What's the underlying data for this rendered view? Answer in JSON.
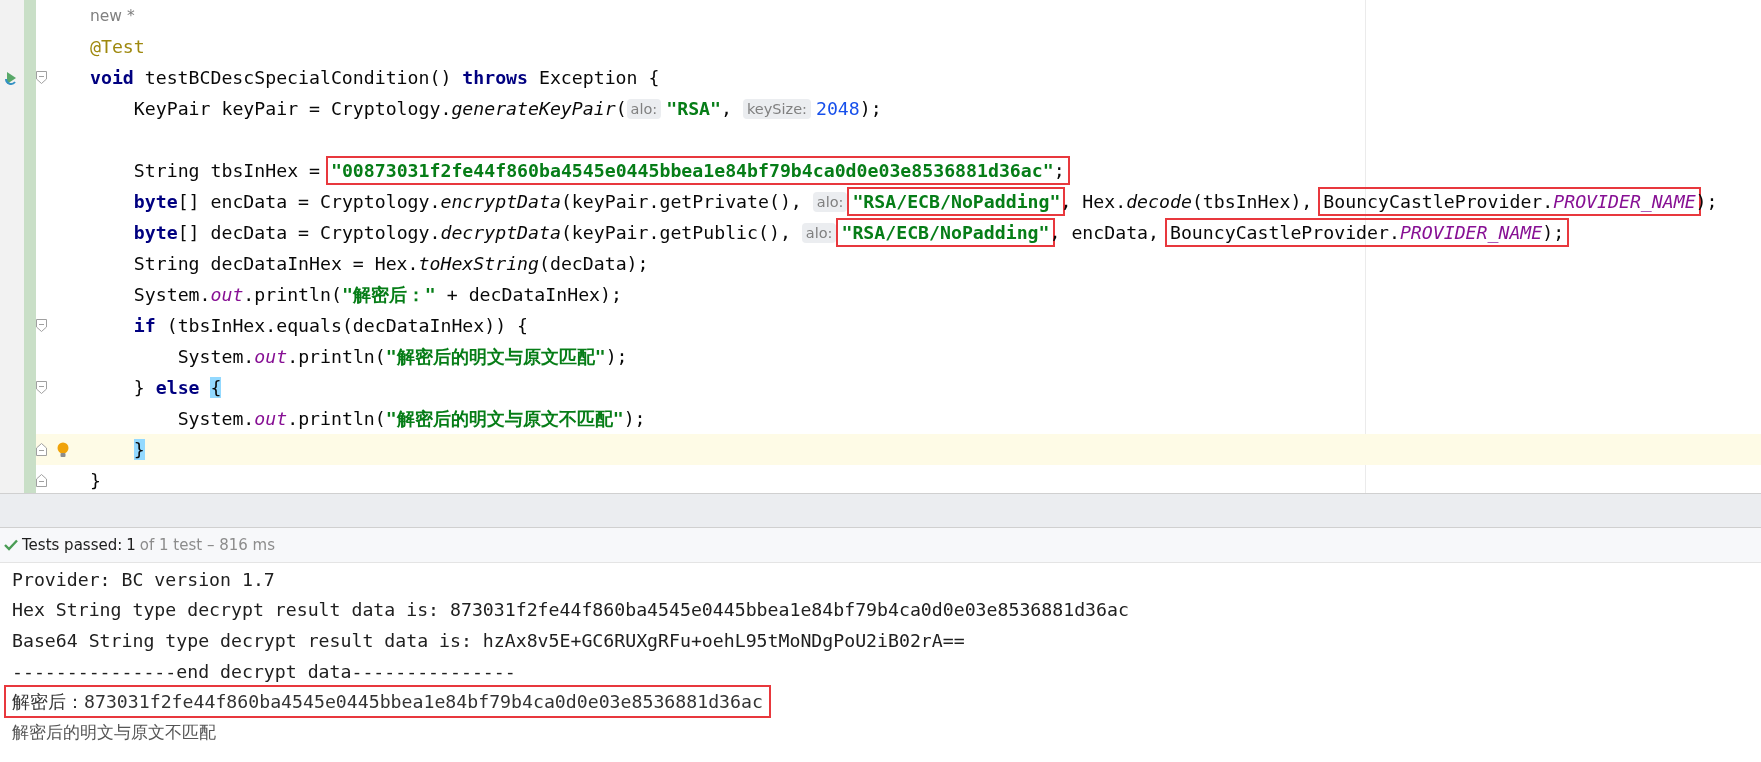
{
  "editor": {
    "lines": [
      {
        "run": false,
        "fold_start": false,
        "fold_end": false,
        "bulb": false,
        "current": false,
        "segments": [
          {
            "kind": "vision",
            "text": "new *"
          }
        ]
      },
      {
        "run": false,
        "fold_start": false,
        "fold_end": false,
        "bulb": false,
        "current": false,
        "segments": [
          {
            "kind": "annotation",
            "text": "@Test"
          }
        ]
      },
      {
        "run": true,
        "fold_start": true,
        "fold_end": false,
        "bulb": false,
        "current": false,
        "segments": [
          {
            "kind": "keyword",
            "text": "void"
          },
          {
            "kind": "plain",
            "text": " testBCDescSpecialCondition() "
          },
          {
            "kind": "keyword",
            "text": "throws"
          },
          {
            "kind": "plain",
            "text": " Exception {"
          }
        ],
        "children": [
          {
            "run": false,
            "fold_start": false,
            "fold_end": false,
            "bulb": false,
            "current": false,
            "segments": [
              {
                "kind": "plain",
                "text": "KeyPair keyPair = Cryptology."
              },
              {
                "kind": "method",
                "text": "generateKeyPair"
              },
              {
                "kind": "plain",
                "text": "("
              },
              {
                "kind": "hint",
                "text": "alo:"
              },
              {
                "kind": "string",
                "text": "\"RSA\""
              },
              {
                "kind": "plain",
                "text": ", "
              },
              {
                "kind": "hint",
                "text": "keySize:"
              },
              {
                "kind": "number",
                "text": "2048"
              },
              {
                "kind": "plain",
                "text": ");"
              }
            ]
          },
          {
            "run": false,
            "fold_start": false,
            "fold_end": false,
            "bulb": false,
            "current": false
          },
          {
            "run": false,
            "fold_start": false,
            "fold_end": false,
            "bulb": false,
            "current": false,
            "segments": [
              {
                "kind": "plain",
                "text": "String tbsInHex = "
              },
              {
                "kind": "group",
                "boxed": true,
                "parts": [
                  {
                    "kind": "string",
                    "text": "\"00873031f2fe44f860ba4545e0445bbea1e84bf79b4ca0d0e03e8536881d36ac\""
                  },
                  {
                    "kind": "plain",
                    "text": ";"
                  }
                ]
              }
            ]
          },
          {
            "run": false,
            "fold_start": false,
            "fold_end": false,
            "bulb": false,
            "current": false,
            "segments": [
              {
                "kind": "keyword",
                "text": "byte"
              },
              {
                "kind": "plain",
                "text": "[] encData = Cryptology."
              },
              {
                "kind": "method",
                "text": "encryptData"
              },
              {
                "kind": "plain",
                "text": "(keyPair.getPrivate(), "
              },
              {
                "kind": "hint",
                "text": "alo:"
              },
              {
                "kind": "group",
                "boxed": true,
                "parts": [
                  {
                    "kind": "string",
                    "text": "\"RSA/ECB/NoPadding\""
                  }
                ]
              },
              {
                "kind": "plain",
                "text": ", Hex."
              },
              {
                "kind": "method",
                "text": "decode"
              },
              {
                "kind": "plain",
                "text": "(tbsInHex), "
              },
              {
                "kind": "group",
                "boxed": true,
                "parts": [
                  {
                    "kind": "plain",
                    "text": "BouncyCastleProvider."
                  },
                  {
                    "kind": "field",
                    "text": "PROVIDER_NAME"
                  }
                ]
              },
              {
                "kind": "plain",
                "text": ");"
              }
            ]
          },
          {
            "run": false,
            "fold_start": false,
            "fold_end": false,
            "bulb": false,
            "current": false,
            "segments": [
              {
                "kind": "keyword",
                "text": "byte"
              },
              {
                "kind": "plain",
                "text": "[] decData = Cryptology."
              },
              {
                "kind": "method",
                "text": "decryptData"
              },
              {
                "kind": "plain",
                "text": "(keyPair.getPublic(), "
              },
              {
                "kind": "hint",
                "text": "alo:"
              },
              {
                "kind": "group",
                "boxed": true,
                "parts": [
                  {
                    "kind": "string",
                    "text": "\"RSA/ECB/NoPadding\""
                  }
                ]
              },
              {
                "kind": "plain",
                "text": ", encData, "
              },
              {
                "kind": "group",
                "boxed": true,
                "parts": [
                  {
                    "kind": "plain",
                    "text": "BouncyCastleProvider."
                  },
                  {
                    "kind": "field",
                    "text": "PROVIDER_NAME"
                  },
                  {
                    "kind": "plain",
                    "text": ");"
                  }
                ]
              }
            ]
          },
          {
            "run": false,
            "fold_start": false,
            "fold_end": false,
            "bulb": false,
            "current": false,
            "segments": [
              {
                "kind": "plain",
                "text": "String decDataInHex = Hex."
              },
              {
                "kind": "method",
                "text": "toHexString"
              },
              {
                "kind": "plain",
                "text": "(decData);"
              }
            ]
          },
          {
            "run": false,
            "fold_start": false,
            "fold_end": false,
            "bulb": false,
            "current": false,
            "segments": [
              {
                "kind": "plain",
                "text": "System."
              },
              {
                "kind": "field",
                "text": "out"
              },
              {
                "kind": "plain",
                "text": ".println("
              },
              {
                "kind": "string",
                "text": "\"解密后：\""
              },
              {
                "kind": "plain",
                "text": " + decDataInHex);"
              }
            ]
          },
          {
            "run": false,
            "fold_start": true,
            "fold_end": false,
            "bulb": false,
            "current": false,
            "segments": [
              {
                "kind": "keyword",
                "text": "if"
              },
              {
                "kind": "plain",
                "text": " (tbsInHex.equals(decDataInHex)) {"
              }
            ],
            "children": [
              {
                "run": false,
                "fold_start": false,
                "fold_end": false,
                "bulb": false,
                "current": false,
                "segments": [
                  {
                    "kind": "plain",
                    "text": "System."
                  },
                  {
                    "kind": "field",
                    "text": "out"
                  },
                  {
                    "kind": "plain",
                    "text": ".println("
                  },
                  {
                    "kind": "string",
                    "text": "\"解密后的明文与原文匹配\""
                  },
                  {
                    "kind": "plain",
                    "text": ");"
                  }
                ]
              }
            ]
          },
          {
            "run": false,
            "fold_start": true,
            "fold_end": false,
            "bulb": false,
            "current": false,
            "segments": [
              {
                "kind": "plain",
                "text": "} "
              },
              {
                "kind": "keyword",
                "text": "else"
              },
              {
                "kind": "brace",
                "text": "{"
              }
            ],
            "children": [
              {
                "run": false,
                "fold_start": false,
                "fold_end": false,
                "bulb": false,
                "current": false,
                "segments": [
                  {
                    "kind": "plain",
                    "text": "System."
                  },
                  {
                    "kind": "field",
                    "text": "out"
                  },
                  {
                    "kind": "plain",
                    "text": ".println("
                  },
                  {
                    "kind": "string",
                    "text": "\"解密后的明文与原文不匹配\""
                  },
                  {
                    "kind": "plain",
                    "text": ");"
                  }
                ]
              }
            ]
          },
          {
            "run": false,
            "fold_start": false,
            "fold_end": true,
            "bulb": true,
            "current": true,
            "segments": [
              {
                "kind": "brace",
                "text": "}"
              }
            ]
          }
        ]
      },
      {
        "run": false,
        "fold_start": false,
        "fold_end": true,
        "bulb": false,
        "current": false,
        "segments": [
          {
            "kind": "plain",
            "text": "}"
          }
        ]
      }
    ]
  },
  "status": {
    "label": "Tests passed:",
    "count": "1",
    "summary": "of 1 test – 816 ms"
  },
  "console": [
    {
      "kind": "mono",
      "boxed": false,
      "text": "Provider: BC version 1.7"
    },
    {
      "kind": "mono",
      "boxed": false,
      "text": "Hex String type decrypt result data is: 873031f2fe44f860ba4545e0445bbea1e84bf79b4ca0d0e03e8536881d36ac"
    },
    {
      "kind": "mono",
      "boxed": false,
      "text": "Base64 String type decrypt result data is: hzAx8v5E+GC6RUXgRFu+oehL95tMoNDgPoU2iB02rA=="
    },
    {
      "kind": "mono",
      "boxed": false,
      "text": "---------------end decrypt data---------------"
    },
    {
      "kind": "mixed",
      "boxed": true,
      "text": "解密后：873031f2fe44f860ba4545e0445bbea1e84bf79b4ca0d0e03e8536881d36ac"
    },
    {
      "kind": "cjk",
      "boxed": false,
      "text": "解密后的明文与原文不匹配"
    }
  ]
}
